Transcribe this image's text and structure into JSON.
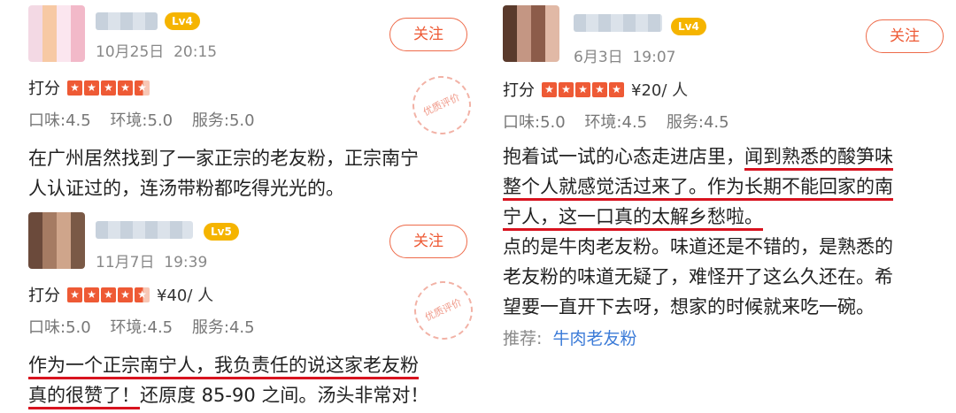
{
  "reviews": [
    {
      "level": "Lv4",
      "date": "10月25日",
      "time": "20:15",
      "follow_label": "关注",
      "rating_label": "打分",
      "price": "",
      "scores": [
        "口味:4.5",
        "环境:5.0",
        "服务:5.0"
      ],
      "body_lines": [
        "在广州居然找到了一家正宗的老友粉，正宗南宁",
        "人认证过的，连汤带粉都吃得光光的。"
      ],
      "stamp_label": "优质评价"
    },
    {
      "level": "Lv5",
      "date": "11月7日",
      "time": "19:39",
      "follow_label": "关注",
      "rating_label": "打分",
      "price": "¥40/ 人",
      "scores": [
        "口味:5.0",
        "环境:4.5",
        "服务:4.5"
      ],
      "body_line1": "作为一个正宗南宁人，我负责任的说这家老友粉",
      "body_line2_underlined": "真的很赞了！",
      "body_line2_rest": "还原度 85-90 之间。汤头非常对！",
      "stamp_label": "优质评价"
    },
    {
      "level": "Lv4",
      "date": "6月3日",
      "time": "19:07",
      "follow_label": "关注",
      "rating_label": "打分",
      "price": "¥20/ 人",
      "scores": [
        "口味:5.0",
        "环境:4.5",
        "服务:4.5"
      ],
      "body_line1_plain": "抱着试一试的心态走进店里，",
      "body_line1_underlined": "闻到熟悉的酸笋味",
      "body_line2": "整个人就感觉活过来了。作为长期不能回家的南",
      "body_line3": "宁人，这一口真的太解乡愁啦。",
      "body_line4": "点的是牛肉老友粉。味道还是不错的，是熟悉的",
      "body_line5": "老友粉的味道无疑了，难怪开了这么久还在。希",
      "body_line6": "望要一直开下去呀，想家的时候就来吃一碗。",
      "recommend_label": "推荐:",
      "recommend_dish": "牛肉老友粉"
    }
  ],
  "colors": {
    "accent": "#ee5a35",
    "level_badge": "#f5b400",
    "underline": "#d8131f",
    "link": "#3b7bd8"
  }
}
